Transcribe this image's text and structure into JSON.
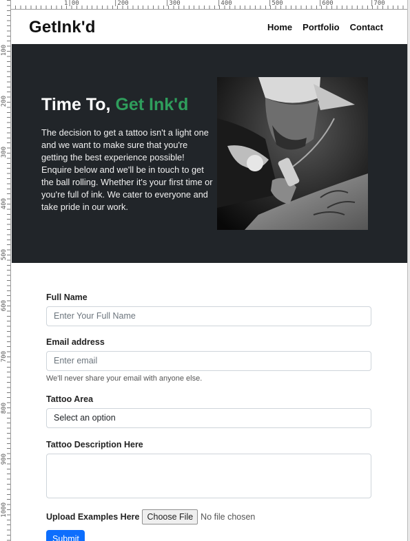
{
  "ruler": {
    "top_ticks": [
      "1|00",
      "|200",
      "|300",
      "|400",
      "|500",
      "|600",
      "|700"
    ],
    "left_ticks": [
      "100",
      "200",
      "300",
      "400",
      "500",
      "600",
      "700",
      "800",
      "900",
      "1000"
    ]
  },
  "navbar": {
    "brand": "GetInk'd",
    "links": [
      "Home",
      "Portfolio",
      "Contact"
    ]
  },
  "hero": {
    "title_prefix": "Time To,",
    "title_accent": "Get Ink'd",
    "accent_color": "#2f9e5c",
    "background_color": "#212529",
    "description": "The decision to get a tattoo isn't a light one and we want to make sure that you're getting the best experience possible! Enquire below and we'll be in touch to get the ball rolling. Whether it's your first time or you're full of ink. We cater to everyone and take pride in our work.",
    "image": "tattoo-artist-photo"
  },
  "form": {
    "full_name": {
      "label": "Full Name",
      "placeholder": "Enter Your Full Name"
    },
    "email": {
      "label": "Email address",
      "placeholder": "Enter email",
      "help": "We'll never share your email with anyone else."
    },
    "tattoo_area": {
      "label": "Tattoo Area",
      "selected": "Select an option"
    },
    "description": {
      "label": "Tattoo Description Here"
    },
    "upload": {
      "label": "Upload Examples Here",
      "button": "Choose File",
      "status": "No file chosen"
    },
    "submit": {
      "label": "Submit",
      "color": "#0d6efd"
    }
  }
}
